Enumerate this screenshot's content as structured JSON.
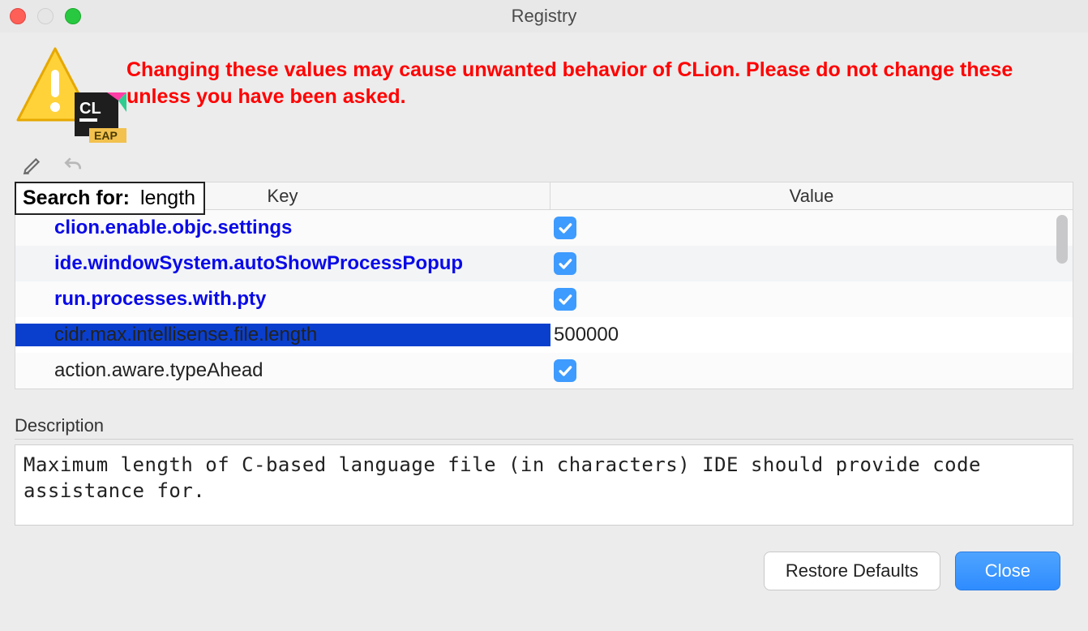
{
  "window": {
    "title": "Registry"
  },
  "warning": {
    "text": "Changing these values may cause unwanted behavior of CLion. Please do not change these unless you have been asked."
  },
  "search": {
    "label": "Search for:",
    "query": "length"
  },
  "table": {
    "headers": {
      "key": "Key",
      "value": "Value"
    },
    "rows": [
      {
        "key": "clion.enable.objc.settings",
        "type": "checkbox",
        "checked": true,
        "modified": true,
        "selected": false
      },
      {
        "key": "ide.windowSystem.autoShowProcessPopup",
        "type": "checkbox",
        "checked": true,
        "modified": true,
        "selected": false
      },
      {
        "key": "run.processes.with.pty",
        "type": "checkbox",
        "checked": true,
        "modified": true,
        "selected": false
      },
      {
        "key": "cidr.max.intellisense.file.length",
        "type": "text",
        "value": "500000",
        "modified": false,
        "selected": true
      },
      {
        "key": "action.aware.typeAhead",
        "type": "checkbox",
        "checked": true,
        "modified": false,
        "selected": false
      }
    ]
  },
  "description": {
    "label": "Description",
    "text": "Maximum length of C-based language file (in characters) IDE should provide code assistance for."
  },
  "footer": {
    "restore": "Restore Defaults",
    "close": "Close"
  },
  "badge": {
    "product": "CL",
    "tag": "EAP"
  }
}
